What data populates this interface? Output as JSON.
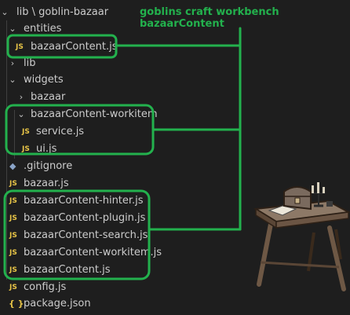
{
  "title": "goblins craft workbench bazaarContent",
  "tree": [
    {
      "key": "lib",
      "label": "lib \\ goblin-bazaar",
      "kind": "folder",
      "open": true,
      "icon": "chevron-down-icon"
    },
    {
      "key": "entities",
      "label": "entities",
      "kind": "folder",
      "open": true,
      "icon": "chevron-down-icon"
    },
    {
      "key": "entities-bazaarContent",
      "label": "bazaarContent.js",
      "kind": "js",
      "icon": "js-icon"
    },
    {
      "key": "lib2",
      "label": "lib",
      "kind": "folder",
      "open": false,
      "icon": "chevron-right-icon"
    },
    {
      "key": "widgets",
      "label": "widgets",
      "kind": "folder",
      "open": true,
      "icon": "chevron-down-icon"
    },
    {
      "key": "bazaar",
      "label": "bazaar",
      "kind": "folder",
      "open": false,
      "icon": "chevron-right-icon"
    },
    {
      "key": "workitem-folder",
      "label": "bazaarContent-workitem",
      "kind": "folder",
      "open": true,
      "icon": "chevron-down-icon"
    },
    {
      "key": "service",
      "label": "service.js",
      "kind": "js",
      "icon": "js-icon"
    },
    {
      "key": "ui",
      "label": "ui.js",
      "kind": "js",
      "icon": "js-icon"
    },
    {
      "key": "gitignore",
      "label": ".gitignore",
      "kind": "gitignore",
      "icon": "gear-icon"
    },
    {
      "key": "bazaar-js",
      "label": "bazaar.js",
      "kind": "js",
      "icon": "js-icon"
    },
    {
      "key": "hinter",
      "label": "bazaarContent-hinter.js",
      "kind": "js",
      "icon": "js-icon"
    },
    {
      "key": "plugin",
      "label": "bazaarContent-plugin.js",
      "kind": "js",
      "icon": "js-icon"
    },
    {
      "key": "search",
      "label": "bazaarContent-search.js",
      "kind": "js",
      "icon": "js-icon"
    },
    {
      "key": "workitem-js",
      "label": "bazaarContent-workitem.js",
      "kind": "js",
      "icon": "js-icon"
    },
    {
      "key": "bazaarContent-js",
      "label": "bazaarContent.js",
      "kind": "js",
      "icon": "js-icon"
    },
    {
      "key": "config",
      "label": "config.js",
      "kind": "js",
      "icon": "js-icon"
    },
    {
      "key": "package",
      "label": "package.json",
      "kind": "json",
      "icon": "braces-icon"
    }
  ],
  "glyphs": {
    "js": "JS",
    "json": "{ }",
    "gitignore": "◆",
    "open": "⌄",
    "closed": "›"
  },
  "colors": {
    "background": "#1e1e1e",
    "text": "#cccccc",
    "js": "#e8c547",
    "highlight": "#23b14d",
    "guide": "#404040"
  }
}
